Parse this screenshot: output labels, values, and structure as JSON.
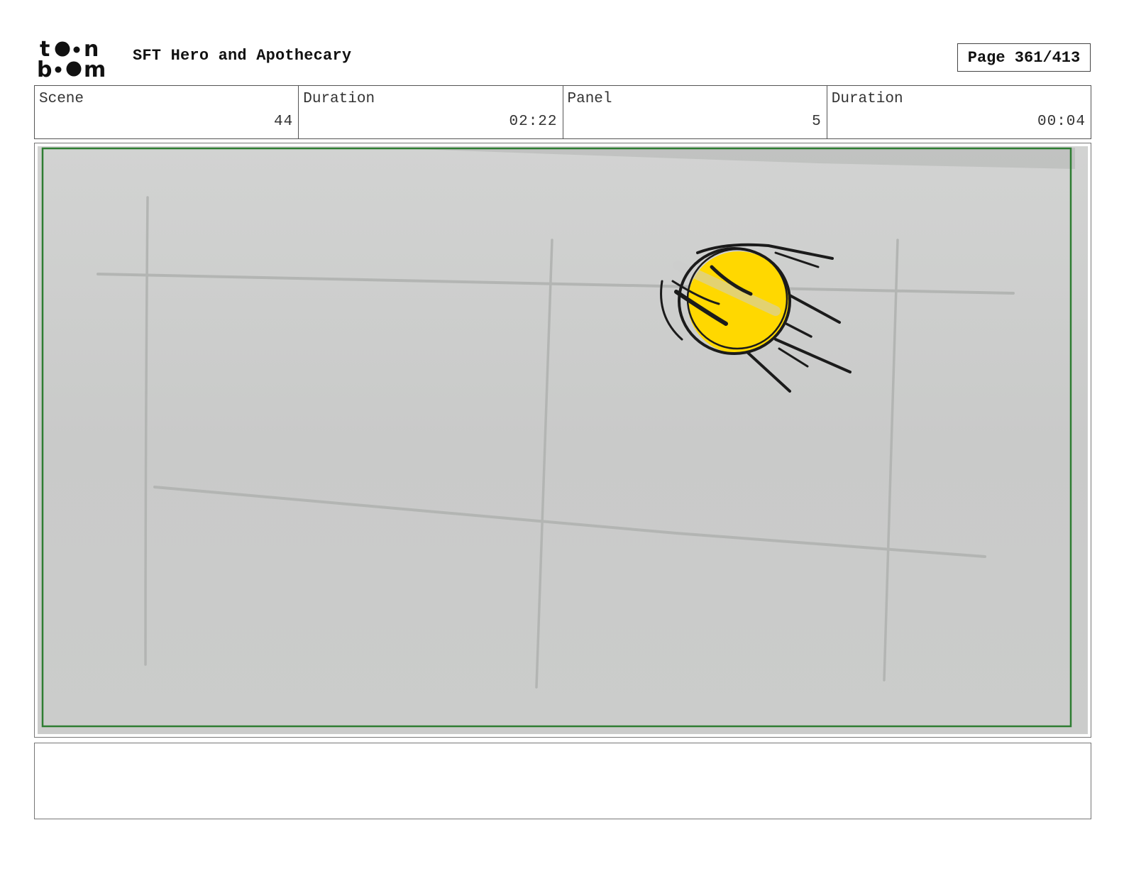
{
  "header": {
    "logo_lines": [
      "toon",
      "boom"
    ],
    "project_title": "SFT Hero and Apothecary",
    "page_label": "Page 361/413"
  },
  "info": {
    "scene_label": "Scene",
    "scene_value": "44",
    "scene_duration_label": "Duration",
    "scene_duration_value": "02:22",
    "panel_label": "Panel",
    "panel_value": "5",
    "panel_duration_label": "Duration",
    "panel_duration_value": "00:04"
  },
  "panel": {
    "background_color": "#cdcecd",
    "safe_frame_color": "#2e7d32",
    "ball_color": "#ffd800",
    "depicts": [
      "grid-wall",
      "flying-yellow-ball"
    ]
  },
  "notes": {
    "text": ""
  }
}
